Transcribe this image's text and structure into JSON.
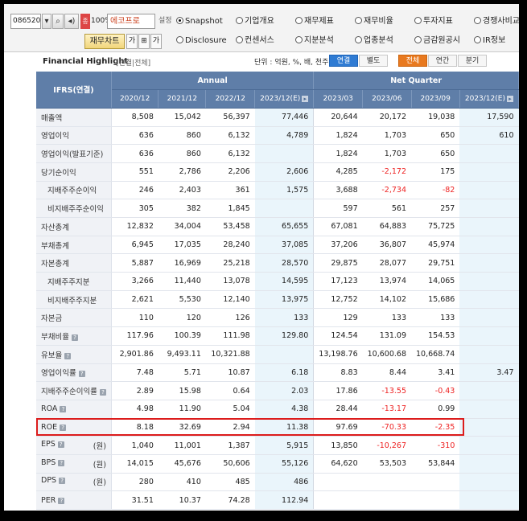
{
  "toolbar": {
    "stock_code": "086520",
    "zoom": "100%",
    "red_tag": "종",
    "company": "에코프로",
    "setting_label": "설정",
    "finance_chart_label": "재무차트",
    "icons": [
      "dropdown-icon",
      "search-icon",
      "speaker-icon",
      "font-bigger-icon",
      "view-toggle-icon",
      "font-smaller-icon"
    ],
    "radio_rows": [
      [
        {
          "label": "Snapshot",
          "on": true
        },
        {
          "label": "기업개요",
          "on": false
        },
        {
          "label": "재무제표",
          "on": false
        },
        {
          "label": "재무비율",
          "on": false
        },
        {
          "label": "투자지표",
          "on": false
        },
        {
          "label": "경쟁사비교",
          "on": false
        }
      ],
      [
        {
          "label": "Disclosure",
          "on": false
        },
        {
          "label": "컨센서스",
          "on": false
        },
        {
          "label": "지분분석",
          "on": false
        },
        {
          "label": "업종분석",
          "on": false
        },
        {
          "label": "금감원공시",
          "on": false
        },
        {
          "label": "IR정보",
          "on": false
        }
      ]
    ]
  },
  "highlight": {
    "title": "Financial Highlight",
    "sub": "[연결|전체]",
    "unit": "단위 : 억원, %, 배, 천주",
    "btn_consolidated": "연결",
    "btn_separate": "별도",
    "btn_all": "전체",
    "btn_annual": "연간",
    "btn_quarter": "분기"
  },
  "table": {
    "corner": "IFRS(연결)",
    "group_annual": "Annual",
    "group_quarter": "Net Quarter",
    "cols": [
      "2020/12",
      "2021/12",
      "2022/12",
      "2023/12(E)",
      "2023/03",
      "2023/06",
      "2023/09",
      "2023/12(E)"
    ],
    "rows": [
      {
        "label": "매출액",
        "indent": false,
        "help": false,
        "unit": "",
        "values": [
          "8,508",
          "15,042",
          "56,397",
          "77,446",
          "20,644",
          "20,172",
          "19,038",
          "17,590"
        ]
      },
      {
        "label": "영업이익",
        "indent": false,
        "help": false,
        "unit": "",
        "values": [
          "636",
          "860",
          "6,132",
          "4,789",
          "1,824",
          "1,703",
          "650",
          "610"
        ]
      },
      {
        "label": "영업이익(발표기준)",
        "indent": false,
        "help": false,
        "unit": "",
        "values": [
          "636",
          "860",
          "6,132",
          "",
          "1,824",
          "1,703",
          "650",
          ""
        ]
      },
      {
        "label": "당기순이익",
        "indent": false,
        "help": false,
        "unit": "",
        "values": [
          "551",
          "2,786",
          "2,206",
          "2,606",
          "4,285",
          "-2,172",
          "175",
          ""
        ]
      },
      {
        "label": "지배주주순이익",
        "indent": true,
        "help": false,
        "unit": "",
        "values": [
          "246",
          "2,403",
          "361",
          "1,575",
          "3,688",
          "-2,734",
          "-82",
          ""
        ]
      },
      {
        "label": "비지배주주순이익",
        "indent": true,
        "help": false,
        "unit": "",
        "values": [
          "305",
          "382",
          "1,845",
          "",
          "597",
          "561",
          "257",
          ""
        ]
      },
      {
        "label": "자산총계",
        "indent": false,
        "help": false,
        "unit": "",
        "values": [
          "12,832",
          "34,004",
          "53,458",
          "65,655",
          "67,081",
          "64,883",
          "75,725",
          ""
        ]
      },
      {
        "label": "부채총계",
        "indent": false,
        "help": false,
        "unit": "",
        "values": [
          "6,945",
          "17,035",
          "28,240",
          "37,085",
          "37,206",
          "36,807",
          "45,974",
          ""
        ]
      },
      {
        "label": "자본총계",
        "indent": false,
        "help": false,
        "unit": "",
        "values": [
          "5,887",
          "16,969",
          "25,218",
          "28,570",
          "29,875",
          "28,077",
          "29,751",
          ""
        ]
      },
      {
        "label": "지배주주지분",
        "indent": true,
        "help": false,
        "unit": "",
        "values": [
          "3,266",
          "11,440",
          "13,078",
          "14,595",
          "17,123",
          "13,974",
          "14,065",
          ""
        ]
      },
      {
        "label": "비지배주주지분",
        "indent": true,
        "help": false,
        "unit": "",
        "values": [
          "2,621",
          "5,530",
          "12,140",
          "13,975",
          "12,752",
          "14,102",
          "15,686",
          ""
        ]
      },
      {
        "label": "자본금",
        "indent": false,
        "help": false,
        "unit": "",
        "values": [
          "110",
          "120",
          "126",
          "133",
          "129",
          "133",
          "133",
          ""
        ]
      },
      {
        "label": "부채비율",
        "indent": false,
        "help": true,
        "unit": "",
        "values": [
          "117.96",
          "100.39",
          "111.98",
          "129.80",
          "124.54",
          "131.09",
          "154.53",
          ""
        ]
      },
      {
        "label": "유보율",
        "indent": false,
        "help": true,
        "unit": "",
        "values": [
          "2,901.86",
          "9,493.11",
          "10,321.88",
          "",
          "13,198.76",
          "10,600.68",
          "10,668.74",
          ""
        ]
      },
      {
        "label": "영업이익률",
        "indent": false,
        "help": true,
        "unit": "",
        "values": [
          "7.48",
          "5.71",
          "10.87",
          "6.18",
          "8.83",
          "8.44",
          "3.41",
          "3.47"
        ]
      },
      {
        "label": "지배주주순이익률",
        "indent": false,
        "help": true,
        "unit": "",
        "values": [
          "2.89",
          "15.98",
          "0.64",
          "2.03",
          "17.86",
          "-13.55",
          "-0.43",
          ""
        ]
      },
      {
        "label": "ROA",
        "indent": false,
        "help": true,
        "unit": "",
        "values": [
          "4.98",
          "11.90",
          "5.04",
          "4.38",
          "28.44",
          "-13.17",
          "0.99",
          ""
        ]
      },
      {
        "label": "ROE",
        "indent": false,
        "help": true,
        "unit": "",
        "values": [
          "8.18",
          "32.69",
          "2.94",
          "11.38",
          "97.69",
          "-70.33",
          "-2.35",
          ""
        ]
      },
      {
        "label": "EPS",
        "indent": false,
        "help": true,
        "unit": "(원)",
        "values": [
          "1,040",
          "11,001",
          "1,387",
          "5,915",
          "13,850",
          "-10,267",
          "-310",
          ""
        ]
      },
      {
        "label": "BPS",
        "indent": false,
        "help": true,
        "unit": "(원)",
        "values": [
          "14,015",
          "45,676",
          "50,606",
          "55,126",
          "64,620",
          "53,503",
          "53,844",
          ""
        ]
      },
      {
        "label": "DPS",
        "indent": false,
        "help": true,
        "unit": "(원)",
        "values": [
          "280",
          "410",
          "485",
          "486",
          "",
          "",
          "",
          ""
        ]
      },
      {
        "label": "PER",
        "indent": false,
        "help": true,
        "unit": "",
        "values": [
          "31.51",
          "10.37",
          "74.28",
          "112.94",
          "",
          "",
          "",
          ""
        ]
      }
    ]
  },
  "colors": {
    "header": "#5f7ea8",
    "estimate": "#eaf5fb",
    "negative": "#e22222",
    "highlight_box": "#dc1c1c"
  }
}
